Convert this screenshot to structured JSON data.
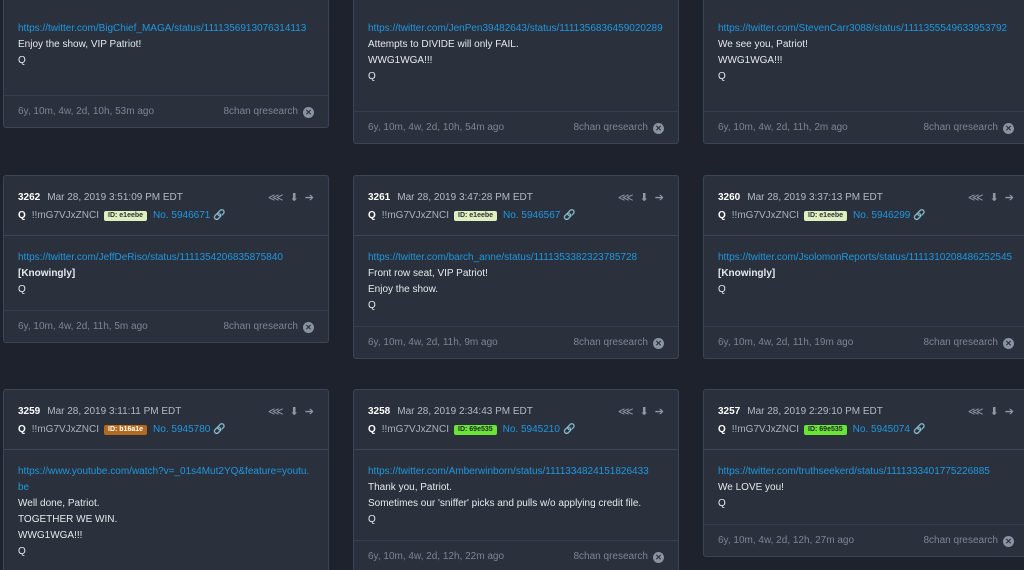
{
  "source_label": "8chan qresearch",
  "top_row": [
    {
      "lines": [
        {
          "text": "https://twitter.com/BigChief_MAGA/status/1111356913076314113",
          "kind": "link"
        },
        {
          "text": "Enjoy the show, VIP Patriot!",
          "kind": "text"
        },
        {
          "text": "Q",
          "kind": "text"
        }
      ],
      "time_ago": "6y, 10m, 4w, 2d, 10h, 53m ago"
    },
    {
      "lines": [
        {
          "text": "https://twitter.com/JenPen39482643/status/1111356836459020289",
          "kind": "link"
        },
        {
          "text": "Attempts to DIVIDE will only FAIL.",
          "kind": "text"
        },
        {
          "text": "WWG1WGA!!!",
          "kind": "text"
        },
        {
          "text": "Q",
          "kind": "text"
        }
      ],
      "time_ago": "6y, 10m, 4w, 2d, 10h, 54m ago"
    },
    {
      "lines": [
        {
          "text": "https://twitter.com/StevenCarr3088/status/1111355549633953792",
          "kind": "link"
        },
        {
          "text": "We see you, Patriot!",
          "kind": "text"
        },
        {
          "text": "WWG1WGA!!!",
          "kind": "text"
        },
        {
          "text": "Q",
          "kind": "text"
        }
      ],
      "time_ago": "6y, 10m, 4w, 2d, 11h, 2m ago"
    }
  ],
  "posts": [
    {
      "number": "3262",
      "date": "Mar 28, 2019 3:51:09 PM EDT",
      "q": "Q",
      "tripcode": "!!mG7VJxZNCI",
      "id": "ID: e1eebe",
      "id_color": "e1eebe",
      "post_no": "No. 5946671",
      "lines": [
        {
          "text": "https://twitter.com/JeffDeRiso/status/1111354206835875840",
          "kind": "link"
        },
        {
          "text": "[Knowingly]",
          "kind": "strong"
        },
        {
          "text": "Q",
          "kind": "text"
        }
      ],
      "time_ago": "6y, 10m, 4w, 2d, 11h, 5m ago"
    },
    {
      "number": "3261",
      "date": "Mar 28, 2019 3:47:28 PM EDT",
      "q": "Q",
      "tripcode": "!!mG7VJxZNCI",
      "id": "ID: e1eebe",
      "id_color": "e1eebe",
      "post_no": "No. 5946567",
      "lines": [
        {
          "text": "https://twitter.com/barch_anne/status/1111353382323785728",
          "kind": "link"
        },
        {
          "text": "Front row seat, VIP Patriot!",
          "kind": "text"
        },
        {
          "text": "Enjoy the show.",
          "kind": "text"
        },
        {
          "text": "Q",
          "kind": "text"
        }
      ],
      "time_ago": "6y, 10m, 4w, 2d, 11h, 9m ago"
    },
    {
      "number": "3260",
      "date": "Mar 28, 2019 3:37:13 PM EDT",
      "q": "Q",
      "tripcode": "!!mG7VJxZNCI",
      "id": "ID: e1eebe",
      "id_color": "e1eebe",
      "post_no": "No. 5946299",
      "lines": [
        {
          "text": "https://twitter.com/JsolomonReports/status/1111310208486252545",
          "kind": "link"
        },
        {
          "text": "[Knowingly]",
          "kind": "strong"
        },
        {
          "text": "Q",
          "kind": "text"
        }
      ],
      "time_ago": "6y, 10m, 4w, 2d, 11h, 19m ago"
    },
    {
      "number": "3259",
      "date": "Mar 28, 2019 3:11:11 PM EDT",
      "q": "Q",
      "tripcode": "!!mG7VJxZNCI",
      "id": "ID: b16a1e",
      "id_color": "b16a1e",
      "post_no": "No. 5945780",
      "lines": [
        {
          "text": "https://www.youtube.com/watch?v=_01s4Mut2YQ&feature=youtu.be",
          "kind": "link"
        },
        {
          "text": "Well done, Patriot.",
          "kind": "text"
        },
        {
          "text": "TOGETHER WE WIN.",
          "kind": "text"
        },
        {
          "text": "WWG1WGA!!!",
          "kind": "text"
        },
        {
          "text": "Q",
          "kind": "text"
        }
      ],
      "time_ago": ""
    },
    {
      "number": "3258",
      "date": "Mar 28, 2019 2:34:43 PM EDT",
      "q": "Q",
      "tripcode": "!!mG7VJxZNCI",
      "id": "ID: 69e535",
      "id_color": "69e535",
      "post_no": "No. 5945210",
      "lines": [
        {
          "text": "https://twitter.com/Amberwinborn/status/1111334824151826433",
          "kind": "link"
        },
        {
          "text": "Thank you, Patriot.",
          "kind": "text"
        },
        {
          "text": "Sometimes our 'sniffer' picks and pulls w/o applying credit file.",
          "kind": "text"
        },
        {
          "text": "Q",
          "kind": "text"
        }
      ],
      "time_ago": "6y, 10m, 4w, 2d, 12h, 22m ago"
    },
    {
      "number": "3257",
      "date": "Mar 28, 2019 2:29:10 PM EDT",
      "q": "Q",
      "tripcode": "!!mG7VJxZNCI",
      "id": "ID: 69e535",
      "id_color": "69e535",
      "post_no": "No. 5945074",
      "lines": [
        {
          "text": "https://twitter.com/truthseekerd/status/1111333401775226885",
          "kind": "link"
        },
        {
          "text": "We LOVE you!",
          "kind": "text"
        },
        {
          "text": "Q",
          "kind": "text"
        }
      ],
      "time_ago": "6y, 10m, 4w, 2d, 12h, 27m ago"
    }
  ]
}
